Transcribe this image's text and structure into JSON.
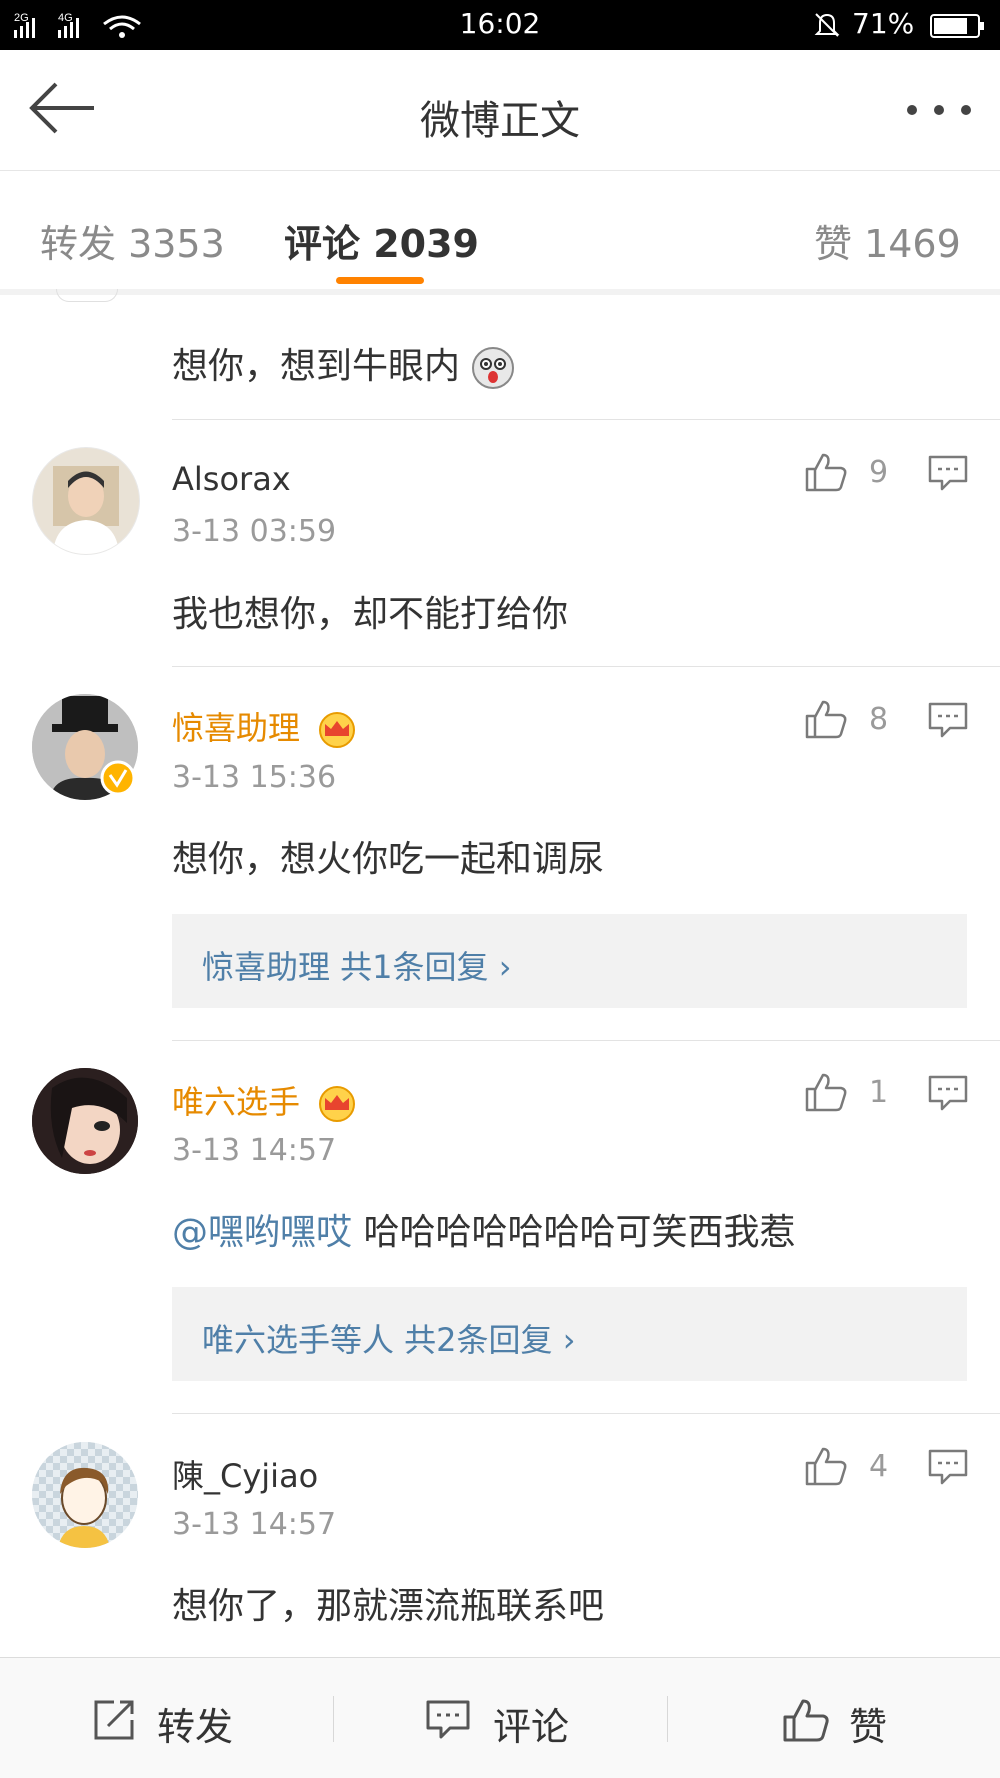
{
  "status_bar": {
    "signal1": "2G",
    "signal2": "4G",
    "time": "16:02",
    "battery": "71%"
  },
  "header": {
    "title": "微博正文",
    "back_icon": "arrow-left-icon",
    "more_icon": "more-dots-icon"
  },
  "tabs": [
    {
      "label": "转发 3353"
    },
    {
      "label": "评论 2039"
    },
    {
      "label": "赞 1469"
    }
  ],
  "comments": [
    {
      "text": "想你，想到牛眼内"
    },
    {
      "username": "Alsorax",
      "time": "3-13 03:59",
      "likes": "9",
      "text": "我也想你，却不能打给你"
    },
    {
      "username": "惊喜助理",
      "time": "3-13 15:36",
      "likes": "8",
      "text": "想你，想火你吃一起和调尿",
      "replies": "惊喜助理  共1条回复 ›"
    },
    {
      "username": "唯六选手",
      "time": "3-13 14:57",
      "likes": "1",
      "mention": "@嘿哟嘿哎",
      "text": " 哈哈哈哈哈哈哈可笑西我惹",
      "replies": "唯六选手等人  共2条回复 ›"
    },
    {
      "username": "陳_Cyjiao",
      "time": "3-13 14:57",
      "likes": "4",
      "text": "想你了，那就漂流瓶联系吧"
    }
  ],
  "bottom_bar": {
    "repost": "转发",
    "comment": "评论",
    "like": "赞"
  },
  "colors": {
    "accent": "#ff8200",
    "vip_name": "#e68a00",
    "link": "#4f7fa8"
  }
}
